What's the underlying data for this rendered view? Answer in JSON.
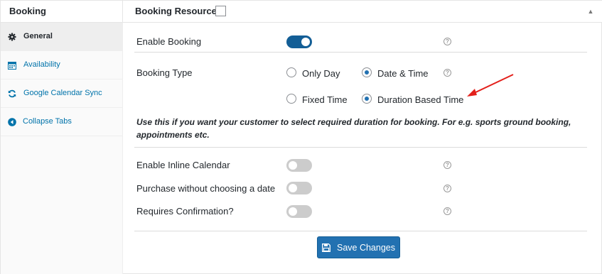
{
  "header": {
    "title": "Booking",
    "resource_label": "Booking Resource:"
  },
  "sidebar": {
    "items": [
      {
        "label": "General",
        "icon": "gear-icon"
      },
      {
        "label": "Availability",
        "icon": "calendar-icon"
      },
      {
        "label": "Google Calendar Sync",
        "icon": "refresh-icon"
      },
      {
        "label": "Collapse Tabs",
        "icon": "collapse-arrow-icon"
      }
    ]
  },
  "settings": {
    "enable_booking": {
      "label": "Enable Booking",
      "enabled": true
    },
    "booking_type": {
      "label": "Booking Type",
      "options": [
        "Only Day",
        "Date & Time",
        "Fixed Time",
        "Duration Based Time"
      ],
      "selected": [
        "Date & Time",
        "Duration Based Time"
      ]
    },
    "note": "Use this if you want your customer to select required duration for booking. For e.g. sports ground booking, appointments etc.",
    "enable_inline_calendar": {
      "label": "Enable Inline Calendar",
      "enabled": false
    },
    "purchase_without_date": {
      "label": "Purchase without choosing a date",
      "enabled": false
    },
    "requires_confirmation": {
      "label": "Requires Confirmation?",
      "enabled": false
    },
    "help_glyph": "?"
  },
  "save_button": {
    "label": "Save Changes"
  },
  "colors": {
    "accent": "#2271b1",
    "arrow": "#e3201b"
  }
}
